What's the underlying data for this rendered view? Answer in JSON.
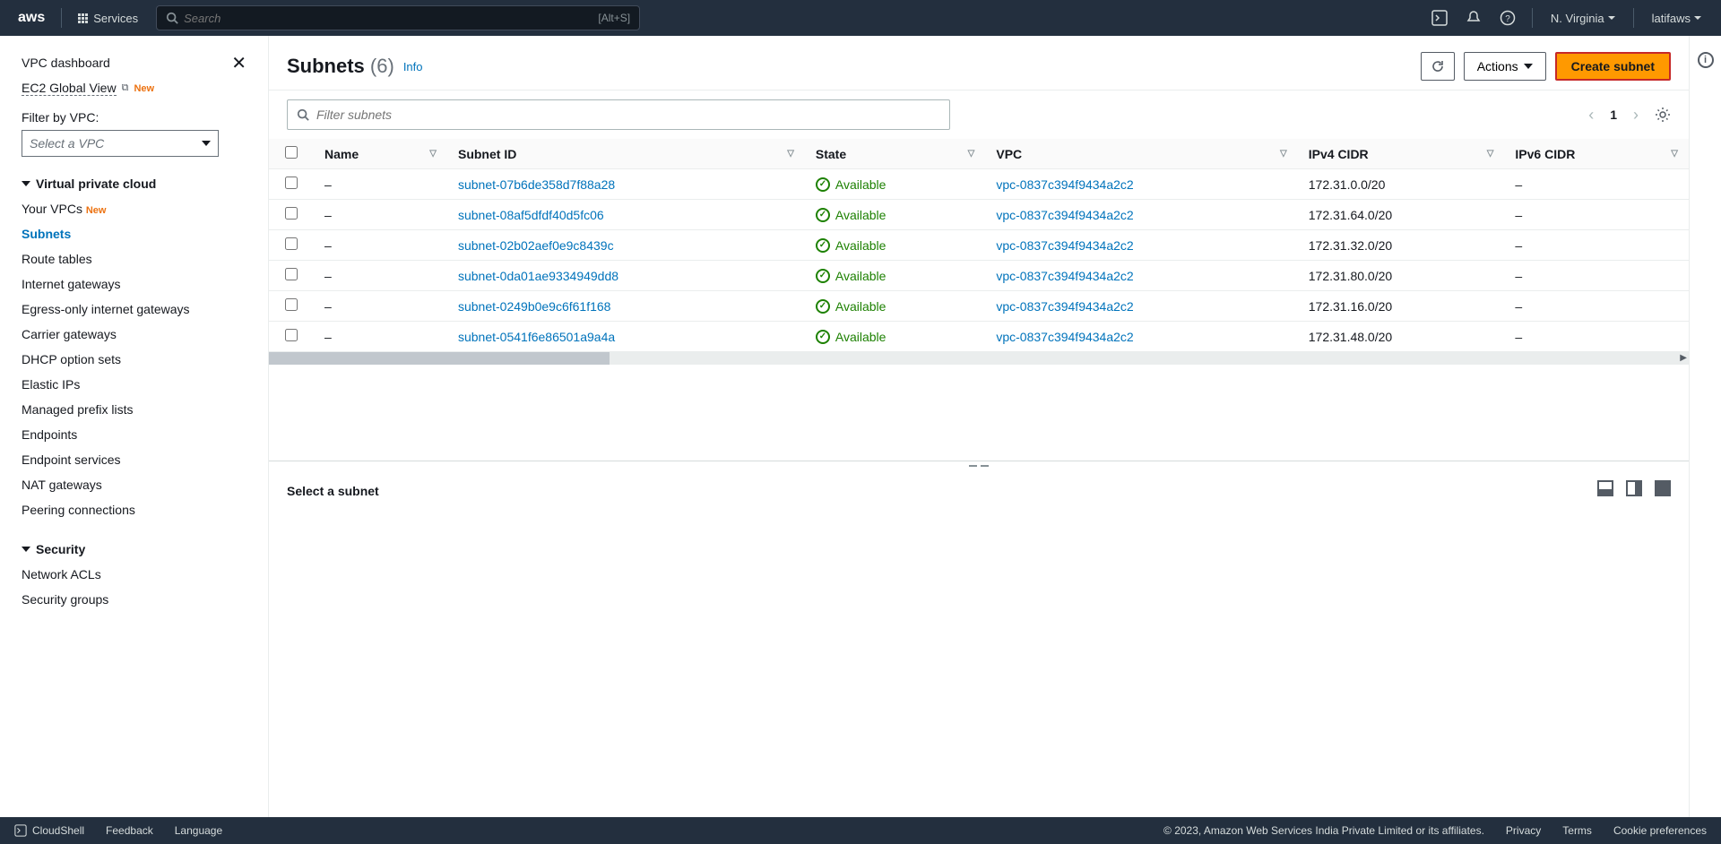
{
  "topnav": {
    "services": "Services",
    "search_placeholder": "Search",
    "search_kbd": "[Alt+S]",
    "region": "N. Virginia",
    "account": "latifaws"
  },
  "sidebar": {
    "dashboard": "VPC dashboard",
    "ec2_global": "EC2 Global View",
    "new_badge": "New",
    "filter_label": "Filter by VPC:",
    "vpc_select_placeholder": "Select a VPC",
    "section_vpc": "Virtual private cloud",
    "section_security": "Security",
    "items_vpc": [
      "Your VPCs",
      "Subnets",
      "Route tables",
      "Internet gateways",
      "Egress-only internet gateways",
      "Carrier gateways",
      "DHCP option sets",
      "Elastic IPs",
      "Managed prefix lists",
      "Endpoints",
      "Endpoint services",
      "NAT gateways",
      "Peering connections"
    ],
    "items_security": [
      "Network ACLs",
      "Security groups"
    ]
  },
  "header": {
    "title": "Subnets",
    "count_text": "(6)",
    "info": "Info",
    "actions": "Actions",
    "create": "Create subnet"
  },
  "filter": {
    "placeholder": "Filter subnets",
    "page": "1"
  },
  "table": {
    "cols": [
      "Name",
      "Subnet ID",
      "State",
      "VPC",
      "IPv4 CIDR",
      "IPv6 CIDR"
    ],
    "state_label": "Available",
    "rows": [
      {
        "name": "–",
        "subnet": "subnet-07b6de358d7f88a28",
        "vpc": "vpc-0837c394f9434a2c2",
        "cidr4": "172.31.0.0/20",
        "cidr6": "–"
      },
      {
        "name": "–",
        "subnet": "subnet-08af5dfdf40d5fc06",
        "vpc": "vpc-0837c394f9434a2c2",
        "cidr4": "172.31.64.0/20",
        "cidr6": "–"
      },
      {
        "name": "–",
        "subnet": "subnet-02b02aef0e9c8439c",
        "vpc": "vpc-0837c394f9434a2c2",
        "cidr4": "172.31.32.0/20",
        "cidr6": "–"
      },
      {
        "name": "–",
        "subnet": "subnet-0da01ae9334949dd8",
        "vpc": "vpc-0837c394f9434a2c2",
        "cidr4": "172.31.80.0/20",
        "cidr6": "–"
      },
      {
        "name": "–",
        "subnet": "subnet-0249b0e9c6f61f168",
        "vpc": "vpc-0837c394f9434a2c2",
        "cidr4": "172.31.16.0/20",
        "cidr6": "–"
      },
      {
        "name": "–",
        "subnet": "subnet-0541f6e86501a9a4a",
        "vpc": "vpc-0837c394f9434a2c2",
        "cidr4": "172.31.48.0/20",
        "cidr6": "–"
      }
    ]
  },
  "detail": {
    "empty": "Select a subnet"
  },
  "footer": {
    "cloudshell": "CloudShell",
    "feedback": "Feedback",
    "language": "Language",
    "copyright": "© 2023, Amazon Web Services India Private Limited or its affiliates.",
    "privacy": "Privacy",
    "terms": "Terms",
    "cookies": "Cookie preferences"
  }
}
